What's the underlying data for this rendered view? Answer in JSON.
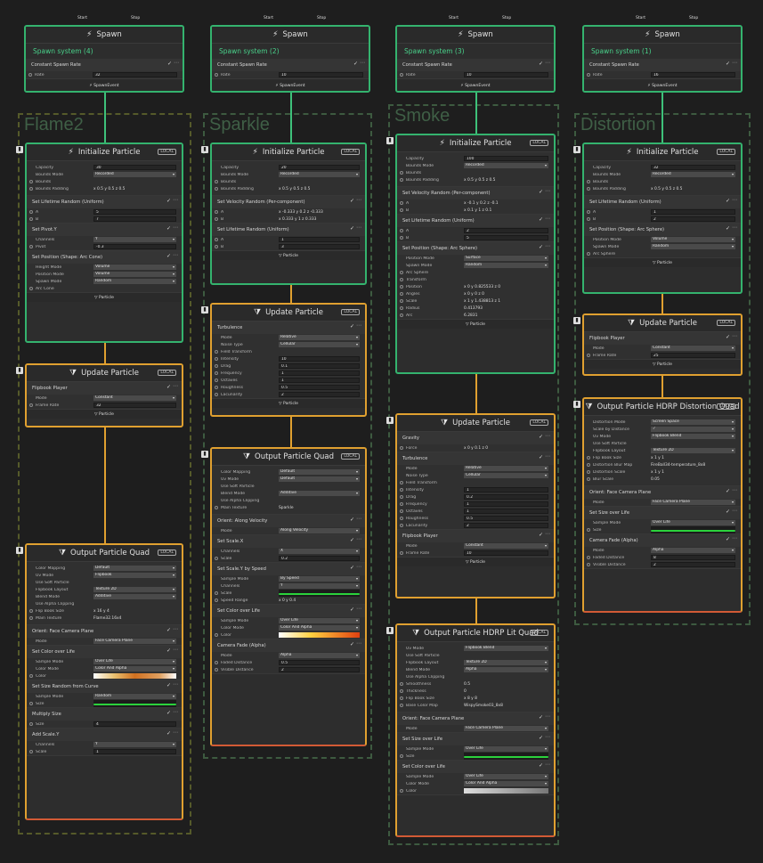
{
  "flow_labels": {
    "start": "Start",
    "stop": "Stop"
  },
  "spawn": [
    {
      "title": "Spawn",
      "name": "Spawn system (4)",
      "block": "Constant Spawn Rate",
      "rate_label": "Rate",
      "rate": "32",
      "event": "SpawnEvent"
    },
    {
      "title": "Spawn",
      "name": "Spawn system (2)",
      "block": "Constant Spawn Rate",
      "rate_label": "Rate",
      "rate": "10",
      "event": "SpawnEvent"
    },
    {
      "title": "Spawn",
      "name": "Spawn system (3)",
      "block": "Constant Spawn Rate",
      "rate_label": "Rate",
      "rate": "10",
      "event": "SpawnEvent"
    },
    {
      "title": "Spawn",
      "name": "Spawn system (1)",
      "block": "Constant Spawn Rate",
      "rate_label": "Rate",
      "rate": "16",
      "event": "SpawnEvent"
    }
  ],
  "groups": [
    "Flame2",
    "Sparkle",
    "Smoke",
    "Distortion"
  ],
  "particle_label": "Particle",
  "init_title": "Initialize Particle",
  "update_title": "Update Particle",
  "flame": {
    "init_rows": [
      [
        "Capacity",
        "30"
      ],
      [
        "Bounds Mode",
        "Recorded"
      ]
    ],
    "bounds": "Bounds",
    "padding": "Bounds Padding",
    "pad_vals": "x 0.5   y 0.5   z 0.5",
    "lifetime": "Set Lifetime Random (Uniform)",
    "a": "5",
    "b": "7",
    "pivot": "Set Pivot.Y",
    "pivot_channels": "Y",
    "pivot_val": "-0.3",
    "arc": "Set Position (Shape: Arc Cone)",
    "arc_rows": [
      [
        "Height Mode",
        "Volume"
      ],
      [
        "Position Mode",
        "Volume"
      ],
      [
        "Spawn Mode",
        "Random"
      ]
    ],
    "arc_label": "Arc Cone",
    "flipbook": "Flipbook Player",
    "fb_mode": "Constant",
    "fb_rate": "32",
    "output": "Output Particle Quad",
    "out_rows": [
      [
        "Color Mapping",
        "Default"
      ],
      [
        "Uv Mode",
        "Flipbook"
      ],
      [
        "Use Soft Particle",
        ""
      ],
      [
        "Flipbook Layout",
        "Texture 2D"
      ],
      [
        "Blend Mode",
        "Additive"
      ],
      [
        "Use Alpha Clipping",
        ""
      ]
    ],
    "flip_size": "x 16    y 4",
    "main_tex": "Flame32.16x4",
    "orient": "Orient: Face Camera Plane",
    "orient_mode": "Face Camera Plane",
    "color": "Set Color over Life",
    "sample": "Over Life",
    "cmode": "Color And Alpha",
    "sizecurve": "Set Size Random from Curve",
    "size_sample": "Random",
    "mult": "Multiply Size",
    "mult_val": "4",
    "scale": "Add Scale.Y",
    "scale_ch": "Y",
    "scale_val": "1"
  },
  "sparkle": {
    "capacity": "20",
    "bmode": "Recorded",
    "vel": "Set Velocity Random (Per-component)",
    "va": "x -0.333  y 0.2  z -0.333",
    "vb": "x 0.333  y 1  z 0.333",
    "lifetime": "Set Lifetime Random (Uniform)",
    "a": "1",
    "b": "3",
    "turb": "Turbulence",
    "turb_rows": [
      [
        "Mode",
        "Relative"
      ],
      [
        "Noise Type",
        "Cellular"
      ]
    ],
    "turb_vals": [
      [
        "Intensity",
        "10"
      ],
      [
        "Drag",
        "0.1"
      ],
      [
        "Frequency",
        "1"
      ],
      [
        "Octaves",
        "1"
      ],
      [
        "Roughness",
        "0.5"
      ],
      [
        "Lacunarity",
        "2"
      ]
    ],
    "output": "Output Particle Quad",
    "out_rows": [
      [
        "Color Mapping",
        "Default"
      ],
      [
        "Uv Mode",
        "Default"
      ],
      [
        "Use Soft Particle",
        ""
      ],
      [
        "Blend Mode",
        "Additive"
      ],
      [
        "Use Alpha Clipping",
        ""
      ]
    ],
    "main_tex": "Sparkle",
    "orient": "Orient: Along Velocity",
    "orient_mode": "Along Velocity",
    "scalex": "Set Scale.X",
    "scalex_ch": "X",
    "scalex_val": "0.2",
    "speed": "Set Scale.Y by Speed",
    "speed_sample": "By Speed",
    "speed_ch": "Y",
    "speed_range": "x 0    y 0.4",
    "color": "Set Color over Life",
    "sample": "Over Life",
    "cmode": "Color And Alpha",
    "fade": "Camera Fade (Alpha)",
    "fade_mode": "Alpha",
    "fade_faded": "0.5",
    "fade_visible": "2"
  },
  "smoke": {
    "capacity": "100",
    "bmode": "Recorded",
    "vel": "Set Velocity Random (Per-component)",
    "va": "x -0.1  y 0.2  z -0.1",
    "vb": "x 0.1  y 1  z 0.1",
    "lifetime": "Set Lifetime Random (Uniform)",
    "a": "2",
    "b": "5",
    "pos": "Set Position (Shape: Arc Sphere)",
    "pos_rows": [
      [
        "Position Mode",
        "Surface"
      ],
      [
        "Spawn Mode",
        "Random"
      ]
    ],
    "sphere": [
      [
        "Position",
        "x 0   y 0.825533  z 0"
      ],
      [
        "Angles",
        "x 0   y 0   z 0"
      ],
      [
        "Scale",
        "x 1   y 1.438813  z 1"
      ],
      [
        "Radius",
        "0.413793"
      ],
      [
        "Arc",
        "6.2831"
      ]
    ],
    "gravity": "Gravity",
    "force": "x 0   y 0.1   z 0",
    "turb": "Turbulence",
    "turb_rows": [
      [
        "Mode",
        "Relative"
      ],
      [
        "Noise Type",
        "Cellular"
      ]
    ],
    "turb_vals": [
      [
        "Intensity",
        "1"
      ],
      [
        "Drag",
        "0.2"
      ],
      [
        "Frequency",
        "1"
      ],
      [
        "Octaves",
        "1"
      ],
      [
        "Roughness",
        "0.5"
      ],
      [
        "Lacunarity",
        "2"
      ]
    ],
    "flipbook": "Flipbook Player",
    "fb_mode": "Constant",
    "fb_rate": "10",
    "output": "Output Particle HDRP Lit Quad",
    "out_rows": [
      [
        "Uv Mode",
        "Flipbook Blend"
      ],
      [
        "Use Soft Particle",
        ""
      ],
      [
        "Flipbook Layout",
        "Texture 2D"
      ],
      [
        "Blend Mode",
        "Alpha"
      ],
      [
        "Use Alpha Clipping",
        ""
      ]
    ],
    "lit": [
      [
        "Smoothness",
        "0.5"
      ],
      [
        "Thickness",
        "0"
      ],
      [
        "Flip Book Size",
        "x 8    y 8"
      ],
      [
        "Base Color Map",
        "WispySmoke03_8x8"
      ]
    ],
    "orient": "Orient: Face Camera Plane",
    "orient_mode": "Face Camera Plane",
    "size": "Set Size over Life",
    "size_sample": "Over Life",
    "color": "Set Color over Life",
    "sample": "Over Life",
    "cmode": "Color And Alpha"
  },
  "distortion": {
    "capacity": "32",
    "bmode": "Recorded",
    "lifetime": "Set Lifetime Random (Uniform)",
    "a": "1",
    "b": "2",
    "pos": "Set Position (Shape: Arc Sphere)",
    "pos_rows": [
      [
        "Position Mode",
        "Volume"
      ],
      [
        "Spawn Mode",
        "Random"
      ]
    ],
    "arc_label": "Arc Sphere",
    "flipbook": "Flipbook Player",
    "fb_mode": "Constant",
    "fb_rate": "25",
    "output": "Output Particle HDRP Distortion Quad",
    "out_rows": [
      [
        "Distortion Mode",
        "Screen Space"
      ],
      [
        "Scale by Distance",
        "✓"
      ],
      [
        "Uv Mode",
        "Flipbook Blend"
      ],
      [
        "Use Soft Particle",
        ""
      ],
      [
        "Flipbook Layout",
        "Texture 2D"
      ]
    ],
    "dist_vals": [
      [
        "Flip Book Size",
        "x 1    y 1"
      ],
      [
        "Distortion Blur Map",
        "FireBall34-temperature_8x8"
      ],
      [
        "Distortion Scale",
        "x 1    y 1"
      ],
      [
        "Blur Scale",
        "0.05"
      ]
    ],
    "orient": "Orient: Face Camera Plane",
    "orient_mode": "Face Camera Plane",
    "size": "Set Size over Life",
    "size_sample": "Over Life",
    "fade": "Camera Fade (Alpha)",
    "fade_mode": "Alpha",
    "fade_faded": "8",
    "fade_visible": "2"
  },
  "common": {
    "capacity": "Capacity",
    "bounds_mode": "Bounds Mode",
    "bounds": "Bounds",
    "padding": "Bounds Padding",
    "pad_vals": "x 0.5   y 0.5   z 0.5",
    "A": "A",
    "B": "B",
    "channels": "Channels",
    "pivot": "Pivot",
    "mode": "Mode",
    "rate": "Frame Rate",
    "flip": "Flip Book Size",
    "tex": "Main Texture",
    "sample": "Sample Mode",
    "cmode": "Color Mode",
    "color": "Color",
    "size": "Size",
    "scale": "Scale",
    "speed_range": "Speed Range",
    "faded": "Faded Distance",
    "visible": "Visible Distance",
    "force": "Force",
    "fieldtr": "Field Transform",
    "arc_cone": "Arc Cone",
    "arc_sphere": "Arc Sphere",
    "transform": "Transform"
  }
}
